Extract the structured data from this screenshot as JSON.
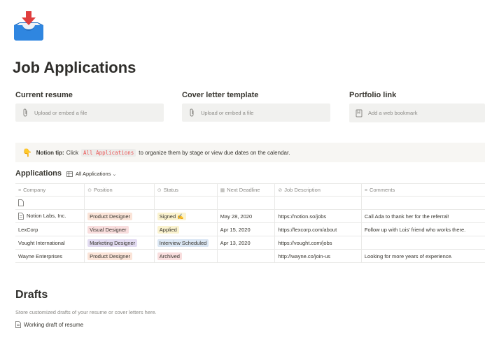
{
  "page": {
    "icon": "inbox-tray-download-icon",
    "title": "Job Applications"
  },
  "embeds": [
    {
      "label": "Current resume",
      "placeholder": "Upload or embed a file",
      "icon": "paperclip-icon"
    },
    {
      "label": "Cover letter template",
      "placeholder": "Upload or embed a file",
      "icon": "paperclip-icon"
    },
    {
      "label": "Portfolio link",
      "placeholder": "Add a web bookmark",
      "icon": "bookmark-icon"
    }
  ],
  "tip": {
    "icon": "pointing-hand-icon",
    "prefix": "Notion tip:",
    "text_before": "Click",
    "code": "All Applications",
    "text_after": "to organize them by stage or view due dates on the calendar."
  },
  "database": {
    "title": "Applications",
    "view_label": "All Applications",
    "columns": [
      "Company",
      "Position",
      "Status",
      "Next Deadline",
      "Job Description",
      "Comments"
    ],
    "rows": [
      {
        "company": "",
        "position": "",
        "status": "",
        "deadline": "",
        "url": "",
        "comment": ""
      },
      {
        "company": "Notion Labs, Inc.",
        "position": "Product Designer",
        "status": "Signed ✍️",
        "deadline": "May 28, 2020",
        "url": "https://notion.so/jobs",
        "comment": "Call Ada to thank her for the referral!"
      },
      {
        "company": "LexCorp",
        "position": "Visual Designer",
        "status": "Applied",
        "deadline": "Apr 15, 2020",
        "url": "https://lexcorp.com/about",
        "comment": "Follow up with Lois' friend who works there."
      },
      {
        "company": "Vought International",
        "position": "Marketing Designer",
        "status": "Interview Scheduled",
        "deadline": "Apr 13, 2020",
        "url": "https://vought.com/jobs",
        "comment": ""
      },
      {
        "company": "Wayne Enterprises",
        "position": "Product Designer",
        "status": "Archived",
        "deadline": "",
        "url": "http://wayne.co/join-us",
        "comment": "Looking for more years of experience."
      }
    ]
  },
  "drafts": {
    "title": "Drafts",
    "description": "Store customized drafts of your resume or cover letters here.",
    "item": "Working draft of resume"
  },
  "colors": {
    "position_product": "#fbe4d8",
    "position_visual": "#f9dede",
    "position_marketing": "#e3dcf2",
    "status_signed": "#fbf3cf",
    "status_applied": "#fbf3cf",
    "status_interview": "#dbe7f4",
    "status_archived": "#f9dede",
    "download_arrow": "#e03e3e",
    "tray_blue": "#2b7bd1"
  }
}
